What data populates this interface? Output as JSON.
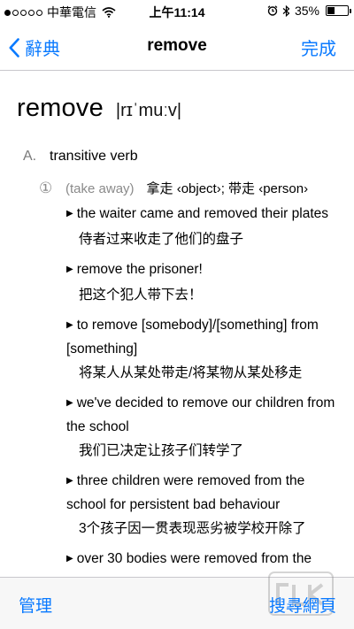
{
  "status_bar": {
    "carrier": "中華電信",
    "time": "上午11:14",
    "battery": "35%",
    "battery_level": 0.35,
    "signal_dots": [
      true,
      false,
      false,
      false,
      false
    ]
  },
  "nav": {
    "back_label": "辭典",
    "title": "remove",
    "done_label": "完成"
  },
  "entry": {
    "headword": "remove",
    "pronunciation": "|rɪˈmuːv|",
    "pos_letter": "A.",
    "pos": "transitive verb",
    "sense_number": "①",
    "sense_gloss": "(take away)",
    "sense_translation": "拿走 ‹object›; 带走 ‹person›",
    "examples": [
      {
        "en": "the waiter came and removed their plates",
        "zh": "侍者过来收走了他们的盘子"
      },
      {
        "en": "remove the prisoner!",
        "zh": "把这个犯人带下去！"
      },
      {
        "en": "to remove [somebody]/[something] from [something]",
        "zh": "将某人从某处带走/将某物从某处移走"
      },
      {
        "en": "we've decided to remove our children from the school",
        "zh": "我们已决定让孩子们转学了"
      },
      {
        "en": "three children were removed from the school for persistent bad behaviour",
        "zh": "3个孩子因一贯表现恶劣被学校开除了"
      },
      {
        "en": "over 30 bodies were removed from the",
        "zh": ""
      }
    ]
  },
  "toolbar": {
    "manage_label": "管理",
    "search_web_label": "搜尋網頁"
  },
  "colors": {
    "accent": "#0a7aff",
    "separator": "#c8c7cc",
    "muted": "#8a8a8a"
  }
}
